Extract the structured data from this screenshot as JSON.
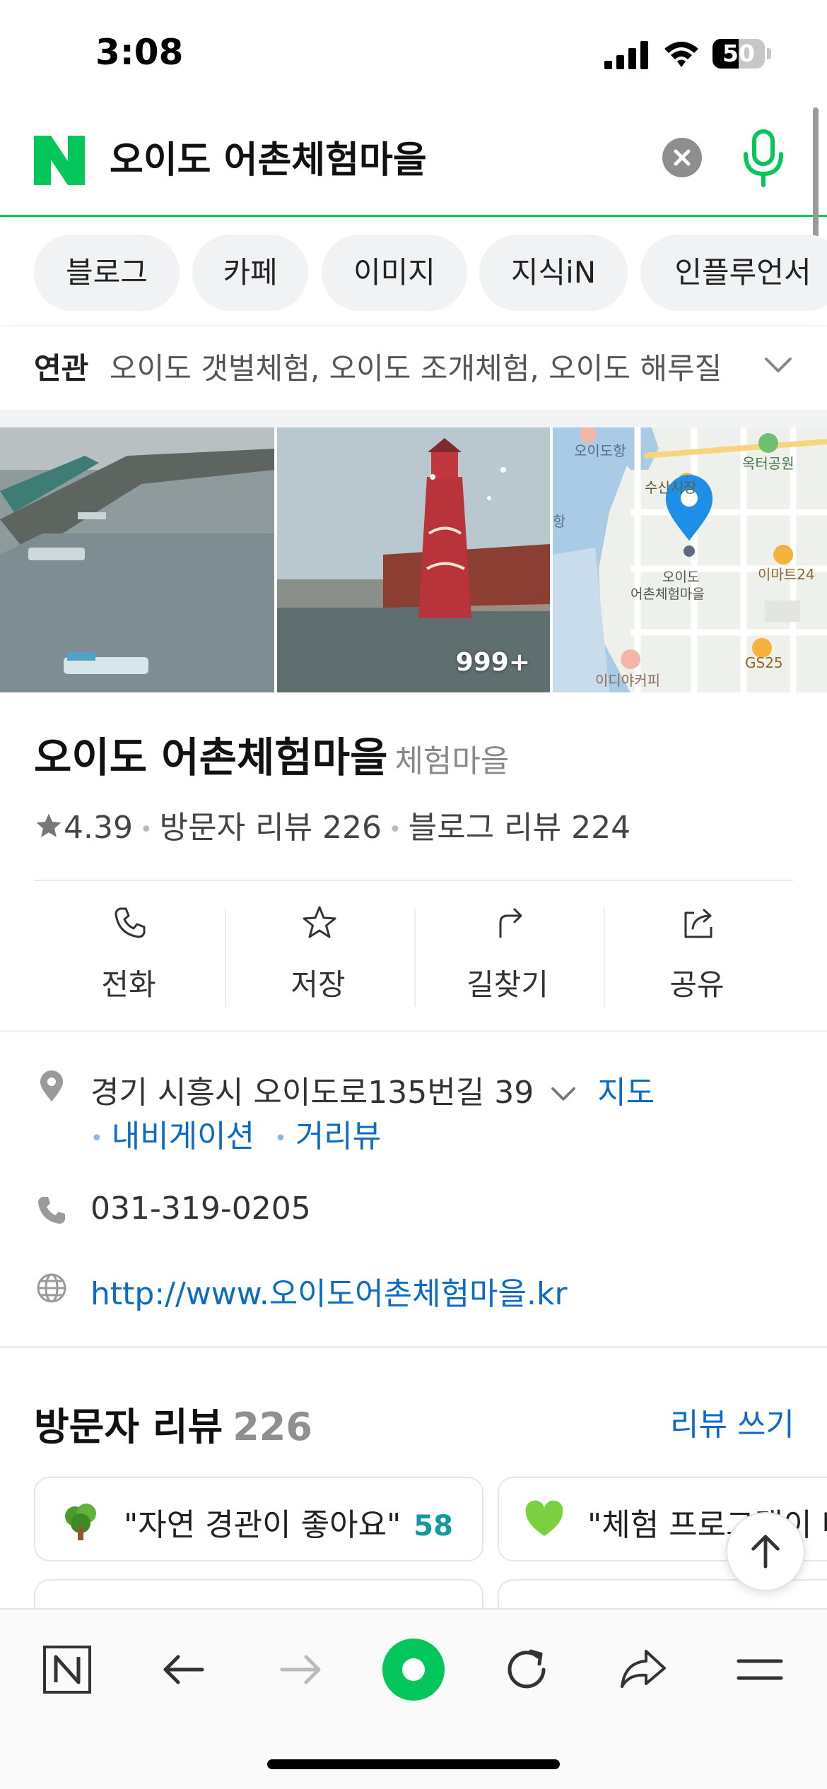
{
  "status_bar": {
    "time": "3:08",
    "battery": "50",
    "battery_level": 0.5
  },
  "search": {
    "query": "오이도 어촌체험마을"
  },
  "tabs": [
    {
      "label": "블로그"
    },
    {
      "label": "카페"
    },
    {
      "label": "이미지"
    },
    {
      "label": "지식iN"
    },
    {
      "label": "인플루언서"
    }
  ],
  "related": {
    "label": "연관",
    "text": "오이도 갯벌체험, 오이도 조개체험, 오이도 해루질"
  },
  "photos": {
    "count_badge": "999+",
    "map_labels": {
      "harbor": "오이도항",
      "park": "옥터공원",
      "market": "수산시장",
      "pin": "오이도\n어촌체험마을",
      "emart": "이마트24",
      "gs": "GS25",
      "cafe": "이디야커피",
      "left_edge": "항"
    }
  },
  "place": {
    "name": "오이도 어촌체험마을",
    "category": "체험마을",
    "rating": "4.39",
    "visitor_reviews": "방문자 리뷰 226",
    "blog_reviews": "블로그 리뷰 224"
  },
  "actions": [
    {
      "label": "전화",
      "icon": "phone-icon"
    },
    {
      "label": "저장",
      "icon": "star-icon"
    },
    {
      "label": "길찾기",
      "icon": "directions-icon"
    },
    {
      "label": "공유",
      "icon": "share-icon"
    }
  ],
  "details": {
    "address": "경기 시흥시 오이도로135번길 39",
    "map_link": "지도",
    "navigation_link": "내비게이션",
    "streetview_link": "거리뷰",
    "phone": "031-319-0205",
    "website": "http://www.오이도어촌체험마을.kr"
  },
  "reviews": {
    "heading": "방문자 리뷰",
    "count": "226",
    "write_label": "리뷰 쓰기",
    "chips": [
      {
        "text": "\"자연 경관이 좋아요\"",
        "count": "58",
        "icon": "tree-icon"
      },
      {
        "text": "\"체험 프로그램이 다양해요\"",
        "count": "",
        "icon": "green-heart-icon"
      }
    ]
  },
  "colors": {
    "naver_green": "#03c75a",
    "link_blue": "#0a6cc7",
    "teal_count": "#119aa0",
    "map_pin": "#1d8fe6"
  }
}
